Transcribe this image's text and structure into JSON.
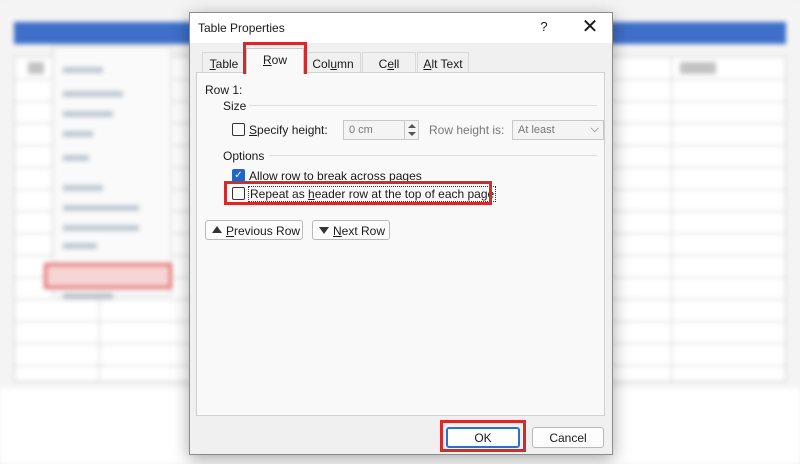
{
  "dialog": {
    "title": "Table Properties",
    "help": "?",
    "close": "✕"
  },
  "tabs": [
    {
      "label": "Table",
      "key": "T"
    },
    {
      "label": "Row",
      "key": "R"
    },
    {
      "label": "Column",
      "key": "U"
    },
    {
      "label": "Cell",
      "key": "E"
    },
    {
      "label": "Alt Text",
      "key": "A"
    }
  ],
  "active_tab": "Row",
  "row_tab": {
    "row_label": "Row 1:",
    "size_label": "Size",
    "specify_height": {
      "pre": "",
      "key": "S",
      "post": "pecify height:",
      "checked": false
    },
    "height_value": "0 cm",
    "row_height_is_label": "Row height is:",
    "row_height_is_value": "At least",
    "options_label": "Options",
    "allow_break": {
      "pre": "Allow row to brea",
      "key": "k",
      "post": " across pages",
      "checked": true
    },
    "repeat_header": {
      "pre": "Repeat as ",
      "key": "h",
      "post": "eader row at the top of each page",
      "checked": false
    },
    "previous_row": {
      "pre": "",
      "key": "P",
      "post": "revious Row"
    },
    "next_row": {
      "pre": "",
      "key": "N",
      "post": "ext Row"
    }
  },
  "footer": {
    "ok": "OK",
    "cancel": "Cancel"
  },
  "colors": {
    "highlight": "#d42a2a",
    "accent": "#1f66c7"
  }
}
